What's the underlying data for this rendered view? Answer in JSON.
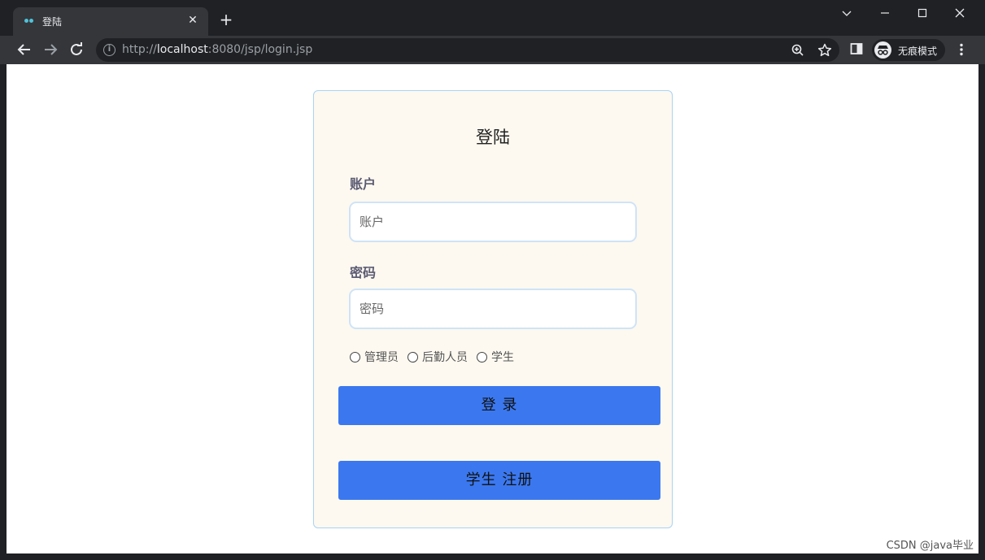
{
  "browser": {
    "tab": {
      "title": "登陆",
      "close": "✕"
    },
    "new_tab": "+",
    "url": {
      "scheme": "http://",
      "host": "localhost",
      "rest": ":8080/jsp/login.jsp"
    },
    "profile_label": "无痕模式"
  },
  "login": {
    "title": "登陆",
    "account_label": "账户",
    "account_placeholder": "账户",
    "account_value": "",
    "password_label": "密码",
    "password_placeholder": "密码",
    "password_value": "",
    "roles": [
      {
        "label": "管理员",
        "checked": false
      },
      {
        "label": "后勤人员",
        "checked": false
      },
      {
        "label": "学生",
        "checked": false
      }
    ],
    "login_button": "登 录",
    "register_button": "学生 注册"
  },
  "watermark": "CSDN @java毕业",
  "colors": {
    "button": "#3b78ef",
    "card_bg": "#fdf9f0",
    "card_border": "#a8d3f5",
    "chrome_dark": "#202124",
    "chrome_toolbar": "#35363a"
  },
  "icons": [
    "back-arrow-icon",
    "forward-arrow-icon",
    "reload-icon",
    "info-icon",
    "zoom-icon",
    "star-icon",
    "side-panel-icon",
    "incognito-icon",
    "menu-dots-icon",
    "chevron-down-icon",
    "minimize-icon",
    "maximize-icon",
    "window-close-icon"
  ]
}
